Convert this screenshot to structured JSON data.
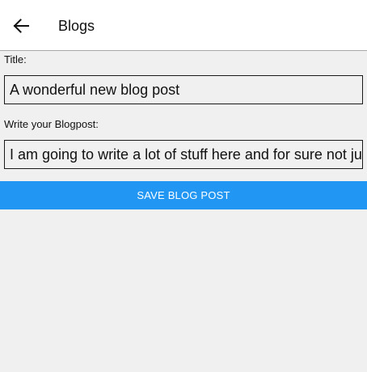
{
  "header": {
    "back_icon": "arrow-left-icon",
    "title": "Blogs"
  },
  "form": {
    "title_label": "Title:",
    "title_value": "A wonderful new blog post",
    "post_label": "Write your Blogpost:",
    "post_value": "I am going to write a lot of stuff here and for sure not just one line"
  },
  "actions": {
    "save_label": "SAVE BLOG POST"
  },
  "colors": {
    "accent": "#2196f3",
    "background": "#f0f0f0",
    "header_background": "#ffffff"
  }
}
